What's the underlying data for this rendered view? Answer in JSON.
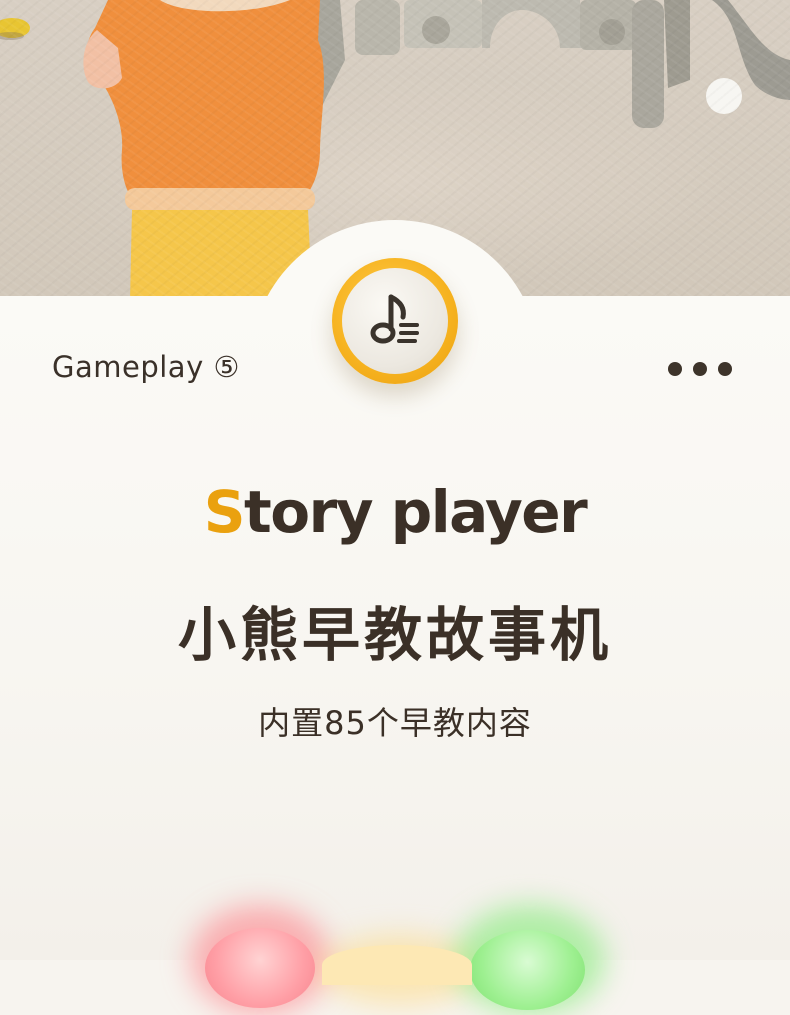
{
  "header": {
    "gameplay_label": "Gameplay ⑤",
    "menu_icon": "more-dots-icon",
    "feature_icon": "music-note-icon",
    "accent_color": "#f6b21f"
  },
  "hero": {
    "title_first_letter": "S",
    "title_rest": "tory player",
    "title_cn": "小熊早教故事机",
    "subtitle": "内置85个早教内容"
  },
  "colors": {
    "text": "#3b3027",
    "title_accent": "#eaa10f",
    "background": "#f8f6f1"
  }
}
